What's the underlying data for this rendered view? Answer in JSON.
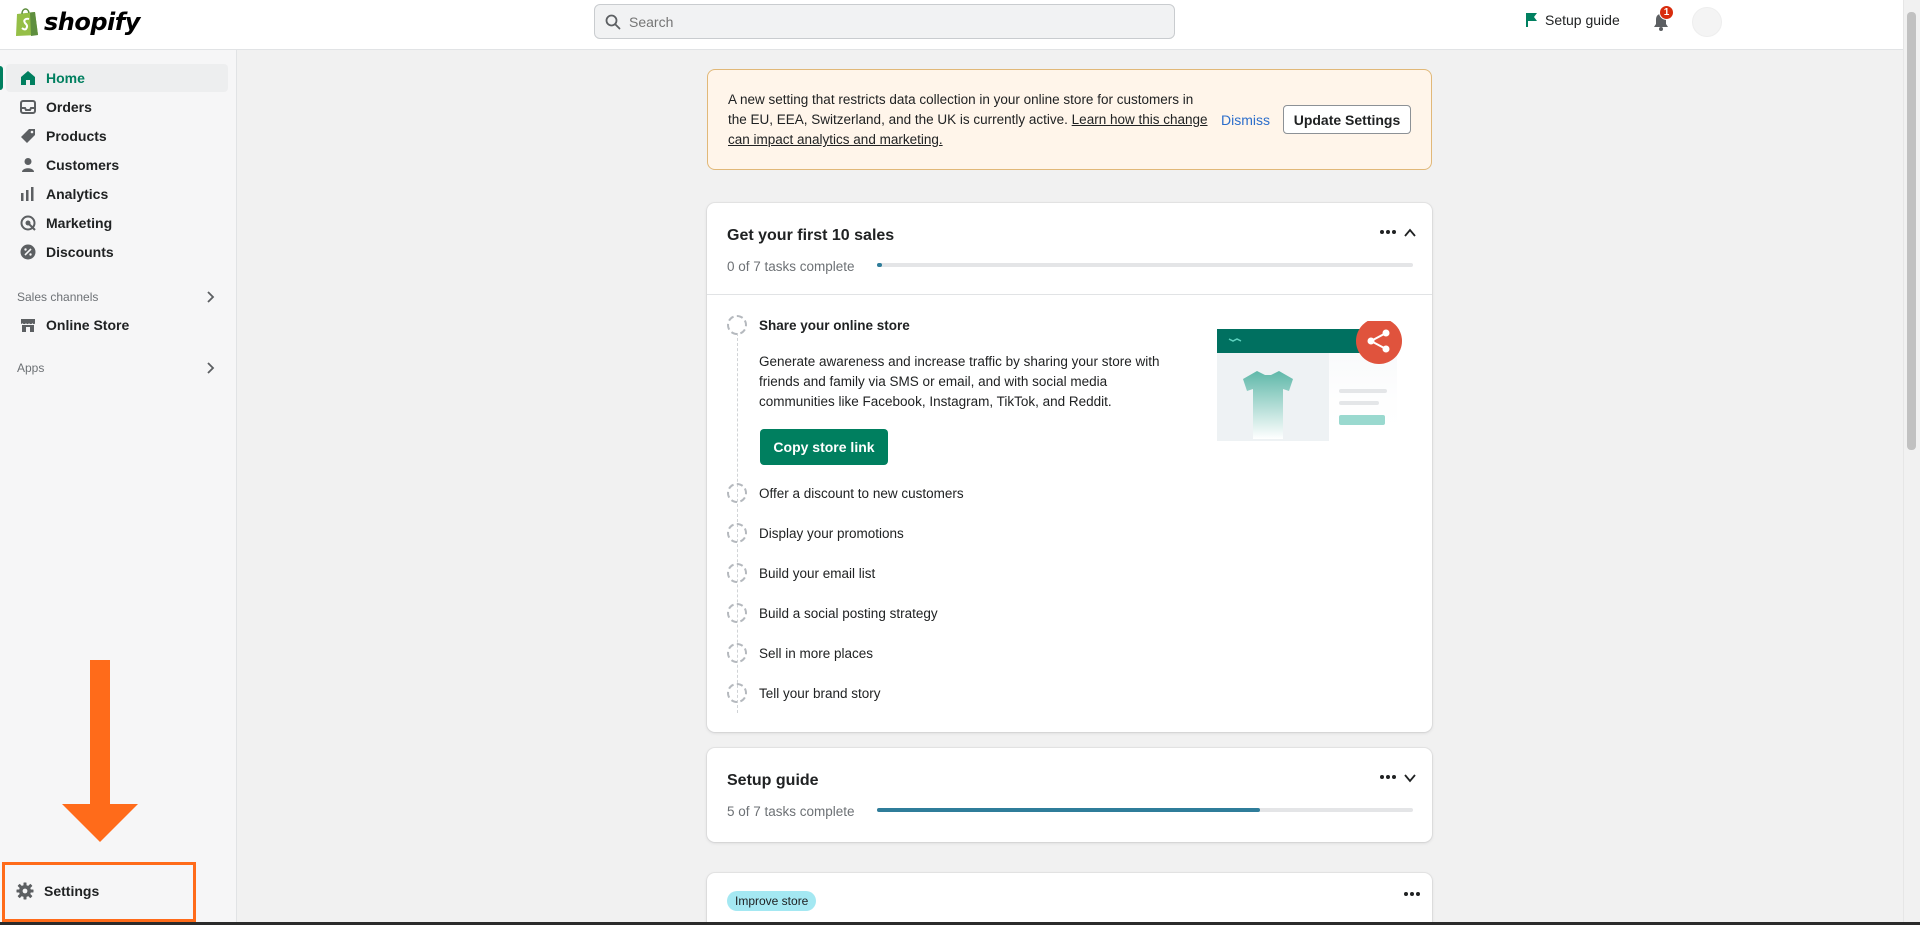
{
  "header": {
    "logo_text": "shopify",
    "search_placeholder": "Search",
    "setup_guide_label": "Setup guide",
    "notification_count": "1"
  },
  "sidebar": {
    "items": [
      {
        "label": "Home",
        "icon": "home-icon",
        "active": true
      },
      {
        "label": "Orders",
        "icon": "orders-icon"
      },
      {
        "label": "Products",
        "icon": "tag-icon"
      },
      {
        "label": "Customers",
        "icon": "person-icon"
      },
      {
        "label": "Analytics",
        "icon": "bar-chart-icon"
      },
      {
        "label": "Marketing",
        "icon": "target-icon"
      },
      {
        "label": "Discounts",
        "icon": "discount-icon"
      }
    ],
    "sales_channels_label": "Sales channels",
    "online_store_label": "Online Store",
    "apps_label": "Apps",
    "settings_label": "Settings"
  },
  "banner": {
    "text_pre": "A new setting that restricts data collection in your online store for customers in the EU, EEA, Switzerland, and the UK is currently active.",
    "link_text": "Learn how this change can impact analytics and marketing.",
    "dismiss_label": "Dismiss",
    "update_label": "Update Settings"
  },
  "first_sales": {
    "title": "Get your first 10 sales",
    "progress_text": "0 of 7 tasks complete",
    "progress_fraction": 0.01,
    "tasks": [
      "Share your online store",
      "Offer a discount to new customers",
      "Display your promotions",
      "Build your email list",
      "Build a social posting strategy",
      "Sell in more places",
      "Tell your brand story"
    ],
    "task_description": "Generate awareness and increase traffic by sharing your store with friends and family via SMS or email, and with social media communities like Facebook, Instagram, TikTok, and Reddit.",
    "copy_button_label": "Copy store link"
  },
  "setup_guide": {
    "title": "Setup guide",
    "progress_text": "5 of 7 tasks complete",
    "progress_fraction": 0.714
  },
  "improve_store": {
    "tag_label": "Improve store"
  },
  "colors": {
    "accent_green": "#007f5f",
    "annotation_orange": "#ff6b1a",
    "progress_blue": "#2f7d9a"
  }
}
